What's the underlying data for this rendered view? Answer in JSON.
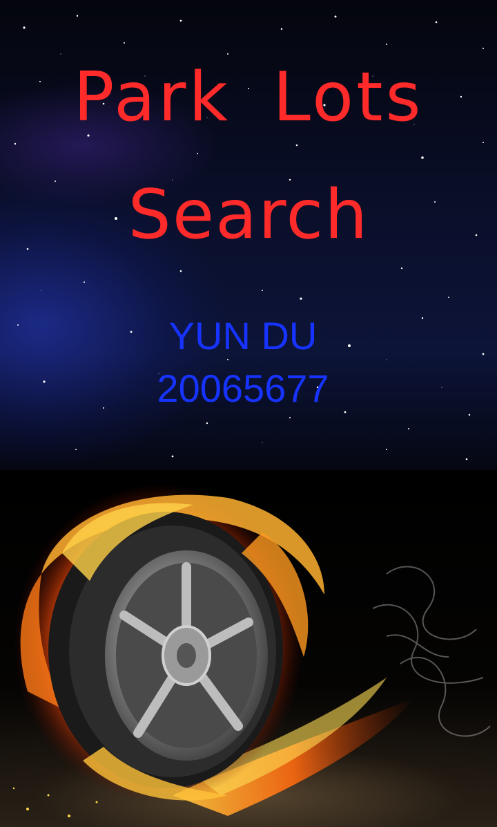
{
  "splash": {
    "title_line1": "Park  Lots",
    "title_line2": "Search",
    "author_name": "YUN DU",
    "student_id": "20065677"
  },
  "colors": {
    "title": "#ff2a2a",
    "subtitle": "#1733ff",
    "background": "#000000"
  },
  "artwork": {
    "icon": "flaming-wheel-icon"
  }
}
